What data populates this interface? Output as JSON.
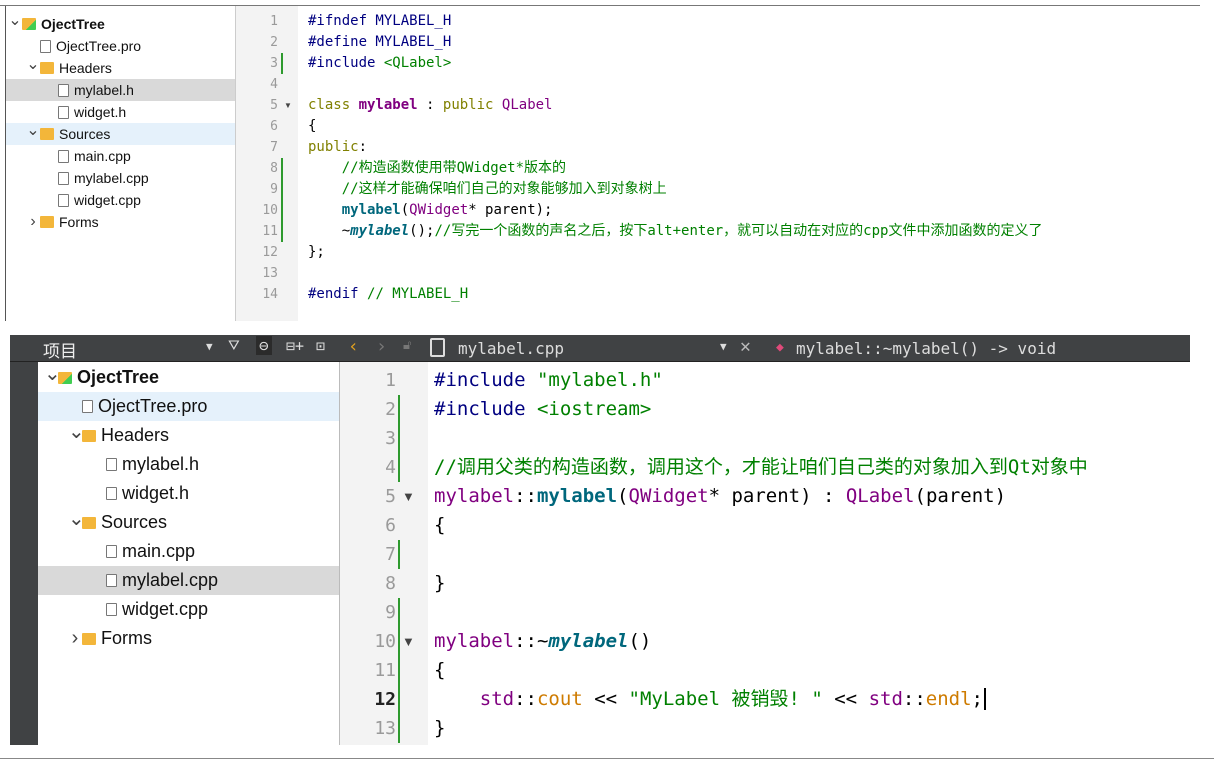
{
  "top": {
    "tree": [
      {
        "label": "OjectTree",
        "type": "project",
        "level": 0,
        "chev": "v",
        "bold": true
      },
      {
        "label": "OjectTree.pro",
        "type": "file",
        "level": 1
      },
      {
        "label": "Headers",
        "type": "folder",
        "level": 1,
        "chev": "v"
      },
      {
        "label": "mylabel.h",
        "type": "file",
        "level": 2,
        "selected": true
      },
      {
        "label": "widget.h",
        "type": "file",
        "level": 2
      },
      {
        "label": "Sources",
        "type": "folder",
        "level": 1,
        "chev": "v",
        "hover": true
      },
      {
        "label": "main.cpp",
        "type": "file",
        "level": 2
      },
      {
        "label": "mylabel.cpp",
        "type": "file",
        "level": 2
      },
      {
        "label": "widget.cpp",
        "type": "file",
        "level": 2
      },
      {
        "label": "Forms",
        "type": "folder",
        "level": 1,
        "chev": ">"
      }
    ],
    "code": [
      [
        [
          "#ifndef MYLABEL_H",
          "pp"
        ]
      ],
      [
        [
          "#define MYLABEL_H",
          "pp"
        ]
      ],
      [
        [
          "#include ",
          "pp"
        ],
        [
          "<QLabel>",
          "str"
        ]
      ],
      [],
      [
        [
          "class ",
          "kw"
        ],
        [
          "mylabel",
          "def"
        ],
        [
          " : ",
          "op"
        ],
        [
          "public ",
          "kw"
        ],
        [
          "QLabel",
          "cls"
        ]
      ],
      [
        [
          "{",
          "op"
        ]
      ],
      [
        [
          "public",
          "kw"
        ],
        [
          ":",
          "op"
        ]
      ],
      [
        [
          "    //构造函数使用带QWidget*版本的",
          "cm"
        ]
      ],
      [
        [
          "    //这样才能确保咱们自己的对象能够加入到对象树上",
          "cm"
        ]
      ],
      [
        [
          "    ",
          "op"
        ],
        [
          "mylabel",
          "fn"
        ],
        [
          "(",
          "op"
        ],
        [
          "QWidget",
          "cls"
        ],
        [
          "* parent);",
          "op"
        ]
      ],
      [
        [
          "    ~",
          "op"
        ],
        [
          "mylabel",
          "dtor"
        ],
        [
          "();",
          "op"
        ],
        [
          "//写完一个函数的声名之后，按下alt+enter，就可以自动在对应的cpp文件中添加函数的定义了",
          "cm"
        ]
      ],
      [
        [
          "};",
          "op"
        ]
      ],
      [],
      [
        [
          "#endif ",
          "pp"
        ],
        [
          "// MYLABEL_H",
          "cm"
        ]
      ]
    ],
    "fold_lines": [
      5
    ]
  },
  "bottom": {
    "toolbar": {
      "panel_title": "项目",
      "file_name": "mylabel.cpp",
      "symbol": "mylabel::~mylabel() -> void"
    },
    "tree": [
      {
        "label": "OjectTree",
        "type": "project",
        "level": 0,
        "chev": "v",
        "bold": true
      },
      {
        "label": "OjectTree.pro",
        "type": "file",
        "level": 1,
        "hover": true
      },
      {
        "label": "Headers",
        "type": "folder",
        "level": 1,
        "chev": "v"
      },
      {
        "label": "mylabel.h",
        "type": "file",
        "level": 2
      },
      {
        "label": "widget.h",
        "type": "file",
        "level": 2
      },
      {
        "label": "Sources",
        "type": "folder",
        "level": 1,
        "chev": "v"
      },
      {
        "label": "main.cpp",
        "type": "file",
        "level": 2
      },
      {
        "label": "mylabel.cpp",
        "type": "file",
        "level": 2,
        "selected": true
      },
      {
        "label": "widget.cpp",
        "type": "file",
        "level": 2
      },
      {
        "label": "Forms",
        "type": "folder",
        "level": 1,
        "chev": ">"
      }
    ],
    "code": [
      [
        [
          "#include ",
          "pp"
        ],
        [
          "\"mylabel.h\"",
          "str"
        ]
      ],
      [
        [
          "#include ",
          "pp"
        ],
        [
          "<iostream>",
          "str"
        ]
      ],
      [],
      [
        [
          "//调用父类的构造函数，调用这个，才能让咱们自己类的对象加入到Qt对象中",
          "cm"
        ]
      ],
      [
        [
          "mylabel",
          "cls"
        ],
        [
          "::",
          "op"
        ],
        [
          "mylabel",
          "fn"
        ],
        [
          "(",
          "op"
        ],
        [
          "QWidget",
          "cls"
        ],
        [
          "* parent) : ",
          "op"
        ],
        [
          "QLabel",
          "cls"
        ],
        [
          "(parent)",
          "op"
        ]
      ],
      [
        [
          "{",
          "op"
        ]
      ],
      [],
      [
        [
          "}",
          "op"
        ]
      ],
      [],
      [
        [
          "mylabel",
          "cls"
        ],
        [
          "::~",
          "op"
        ],
        [
          "mylabel",
          "dtor"
        ],
        [
          "()",
          "op"
        ]
      ],
      [
        [
          "{",
          "op"
        ]
      ],
      [
        [
          "    ",
          "op"
        ],
        [
          "std",
          "std"
        ],
        [
          "::",
          "op"
        ],
        [
          "cout",
          "mem"
        ],
        [
          " << ",
          "op"
        ],
        [
          "\"MyLabel 被销毁! \"",
          "str"
        ],
        [
          " << ",
          "op"
        ],
        [
          "std",
          "std"
        ],
        [
          "::",
          "op"
        ],
        [
          "endl",
          "mem"
        ],
        [
          ";",
          "op"
        ]
      ],
      [
        [
          "}",
          "op"
        ]
      ]
    ],
    "fold_lines": [
      5,
      10
    ],
    "current_line": 12
  }
}
